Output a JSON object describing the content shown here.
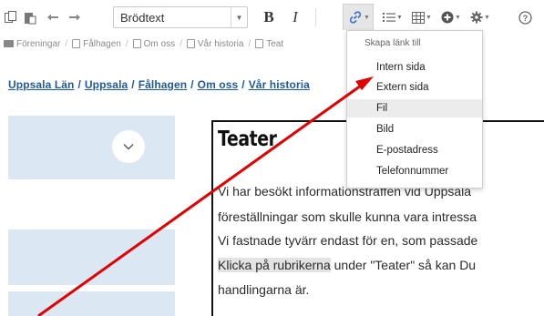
{
  "toolbar": {
    "style_value": "Brödtext",
    "bold_label": "B",
    "italic_label": "I",
    "icons": [
      "paste-text-icon",
      "paste-word-icon",
      "undo-icon",
      "redo-icon",
      "link-icon",
      "list-icon",
      "table-icon",
      "insert-icon",
      "settings-icon",
      "help-icon"
    ]
  },
  "pathbar": {
    "items": [
      "Föreningar",
      "Fålhagen",
      "Om oss",
      "Vår historia",
      "Teat"
    ]
  },
  "breadcrumb": {
    "items": [
      "Uppsala Län",
      "Uppsala",
      "Fålhagen",
      "Om oss",
      "Vår historia"
    ]
  },
  "content": {
    "title": "Teater",
    "lines": [
      "Vi har besökt informationsträffen vid Uppsala",
      "föreställningar som skulle kunna vara intressa",
      "Vi fastnade tyvärr endast för en, som passade",
      "under \"Teater\" så kan Du",
      "handlingarna är."
    ],
    "highlight_text": "Klicka på rubrikerna"
  },
  "link_menu": {
    "heading": "Skapa länk till",
    "items": [
      "Intern sida",
      "Extern sida",
      "Fil",
      "Bild",
      "E-postadress",
      "Telefonnummer"
    ],
    "active_index": 2
  },
  "colors": {
    "link_blue": "#1e5aa0",
    "sidebar_blue": "#dce7f4",
    "annotation_red": "#e00000"
  }
}
